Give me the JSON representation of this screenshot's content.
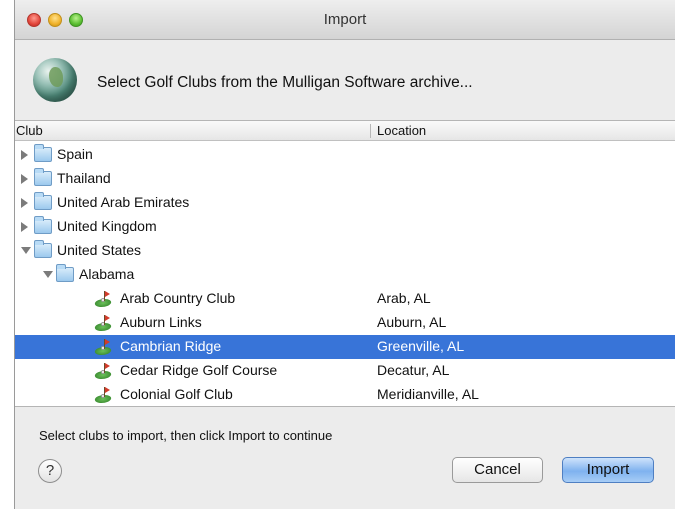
{
  "window": {
    "title": "Import"
  },
  "header": {
    "icon": "globe-icon",
    "message": "Select Golf Clubs from the Mulligan Software archive..."
  },
  "table": {
    "columns": [
      "Club",
      "Location"
    ],
    "rows": [
      {
        "type": "folder",
        "level": 0,
        "expanded": false,
        "name": "Spain",
        "location": ""
      },
      {
        "type": "folder",
        "level": 0,
        "expanded": false,
        "name": "Thailand",
        "location": ""
      },
      {
        "type": "folder",
        "level": 0,
        "expanded": false,
        "name": "United Arab Emirates",
        "location": ""
      },
      {
        "type": "folder",
        "level": 0,
        "expanded": false,
        "name": "United Kingdom",
        "location": ""
      },
      {
        "type": "folder",
        "level": 0,
        "expanded": true,
        "name": "United States",
        "location": ""
      },
      {
        "type": "folder",
        "level": 1,
        "expanded": true,
        "name": "Alabama",
        "location": ""
      },
      {
        "type": "club",
        "level": 2,
        "name": "Arab Country Club",
        "location": "Arab, AL"
      },
      {
        "type": "club",
        "level": 2,
        "name": "Auburn Links",
        "location": "Auburn, AL"
      },
      {
        "type": "club",
        "level": 2,
        "name": "Cambrian Ridge",
        "location": "Greenville, AL",
        "selected": true
      },
      {
        "type": "club",
        "level": 2,
        "name": "Cedar Ridge Golf Course",
        "location": "Decatur, AL"
      },
      {
        "type": "club",
        "level": 2,
        "name": "Colonial Golf Club",
        "location": "Meridianville, AL"
      }
    ]
  },
  "footer": {
    "message": "Select clubs to import, then click Import to continue",
    "help_label": "?",
    "cancel_label": "Cancel",
    "import_label": "Import"
  },
  "colors": {
    "selection": "#3874d8",
    "default_button": "#7fb2ef"
  }
}
